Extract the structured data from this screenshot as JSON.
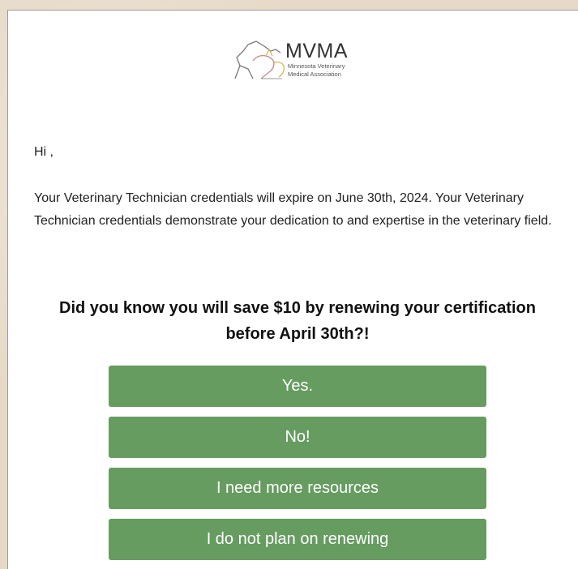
{
  "logo": {
    "title": "MVMA",
    "subtitle_line1": "Minnesota Veterinary",
    "subtitle_line2": "Medical Association"
  },
  "email": {
    "greeting": "Hi ,",
    "body": "Your Veterinary Technician credentials will expire on June 30th, 2024. Your Veterinary Technician credentials demonstrate your dedication to and expertise in the veterinary field.",
    "question": "Did you know you will save $10 by renewing your certification before April 30th?!"
  },
  "buttons": [
    {
      "label": "Yes."
    },
    {
      "label": "No!"
    },
    {
      "label": "I need more resources"
    },
    {
      "label": "I do not plan on renewing"
    }
  ],
  "colors": {
    "button_bg": "#669c60",
    "button_text": "#ffffff",
    "page_bg": "#e6d9c7"
  }
}
